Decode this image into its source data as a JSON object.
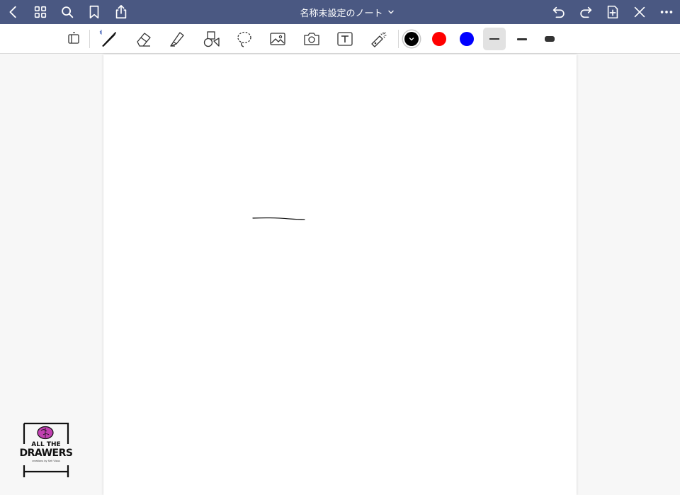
{
  "header": {
    "title": "名称未設定のノート",
    "bg_color": "#4a5882"
  },
  "colors": {
    "black": "#000000",
    "red": "#ff0000",
    "blue": "#0000ff",
    "selected_width_bg": "#e2e2e2"
  },
  "nav_left_icons": [
    "back-chevron-icon",
    "grid-icon",
    "search-icon",
    "bookmark-icon",
    "share-icon"
  ],
  "nav_right_icons": [
    "undo-icon",
    "redo-icon",
    "add-page-icon",
    "close-icon",
    "more-icon"
  ],
  "toolbar_icons": [
    "read-mode-icon",
    "pen-icon",
    "eraser-icon",
    "highlighter-icon",
    "shapes-icon",
    "lasso-icon",
    "image-icon",
    "camera-icon",
    "textbox-icon",
    "laser-pointer-icon"
  ],
  "logo": {
    "line1": "ALL THE",
    "line2": "DRAWERS",
    "line3": "creations by Seh Vious"
  }
}
